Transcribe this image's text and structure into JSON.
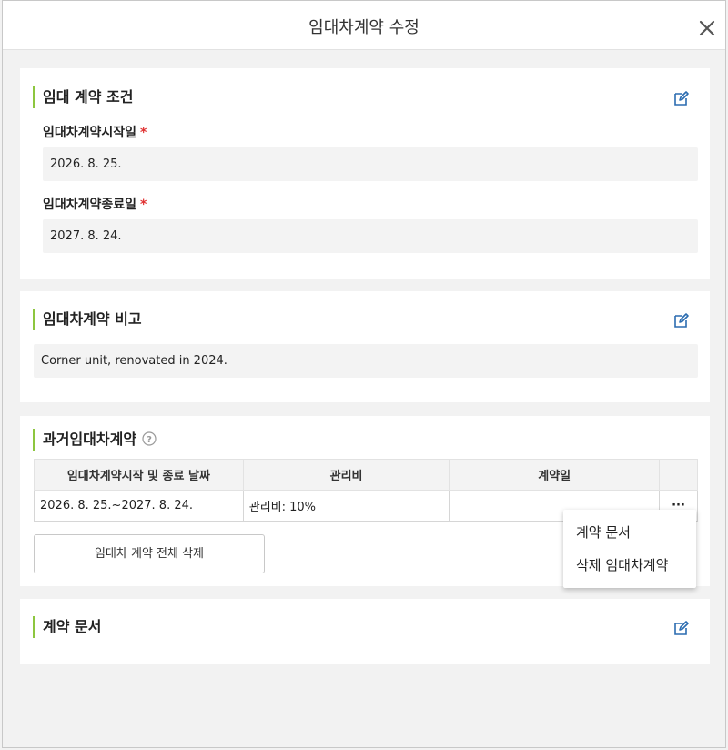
{
  "modal": {
    "title": "임대차계약 수정"
  },
  "lease_terms": {
    "title": "임대 계약 조건",
    "start_label": "임대차계약시작일",
    "start_value": "2026. 8. 25.",
    "end_label": "임대차계약종료일",
    "end_value": "2027. 8. 24.",
    "required_mark": "*"
  },
  "lease_notes": {
    "title": "임대차계약 비고",
    "value": "Corner unit, renovated in 2024."
  },
  "past_leases": {
    "title": "과거임대차계약",
    "columns": [
      "임대차계약시작 및 종료 날짜",
      "관리비",
      "계약일"
    ],
    "rows": [
      {
        "period": "2026. 8. 25.~2027. 8. 24.",
        "fee": "관리비: 10%",
        "contract_date": ""
      }
    ],
    "more_label": "···",
    "delete_all_label": "임대차 계약 전체 삭제"
  },
  "dropdown_menu": {
    "items": [
      "계약 문서",
      "삭제 임대차계약"
    ]
  },
  "contract_docs": {
    "title": "계약 문서"
  },
  "colors": {
    "accent": "#8dc63f",
    "required": "#e03030",
    "icon": "#2b6cb0"
  }
}
